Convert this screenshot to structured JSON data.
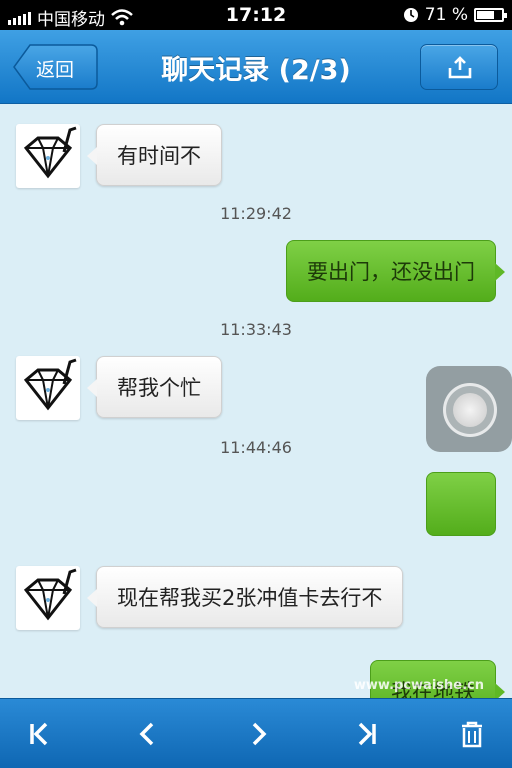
{
  "status_bar": {
    "carrier": "中国移动",
    "time": "17:12",
    "battery": "71 %",
    "battery_level": 0.71
  },
  "nav": {
    "back_label": "返回",
    "title": "聊天记录 (2/3)"
  },
  "messages": [
    {
      "from": "them",
      "text": "有时间不"
    },
    {
      "time": "11:29:42"
    },
    {
      "from": "me",
      "text": "要出门，还没出门"
    },
    {
      "time": "11:33:43"
    },
    {
      "from": "them",
      "text": "帮我个忙"
    },
    {
      "time": "11:44:46"
    },
    {
      "from": "me",
      "type": "image"
    },
    {
      "from": "them",
      "text": "现在帮我买2张冲值卡去行不"
    },
    {
      "from": "me",
      "text": "我在地铁"
    }
  ],
  "toolbar": {
    "buttons": [
      "first-page-icon",
      "prev-page-icon",
      "next-page-icon",
      "last-page-icon",
      "delete-icon"
    ]
  },
  "watermark": "www.pcwaishe.cn",
  "colors": {
    "nav_blue": "#1276c6",
    "bubble_green": "#5fb826",
    "background": "#dbeef6"
  }
}
